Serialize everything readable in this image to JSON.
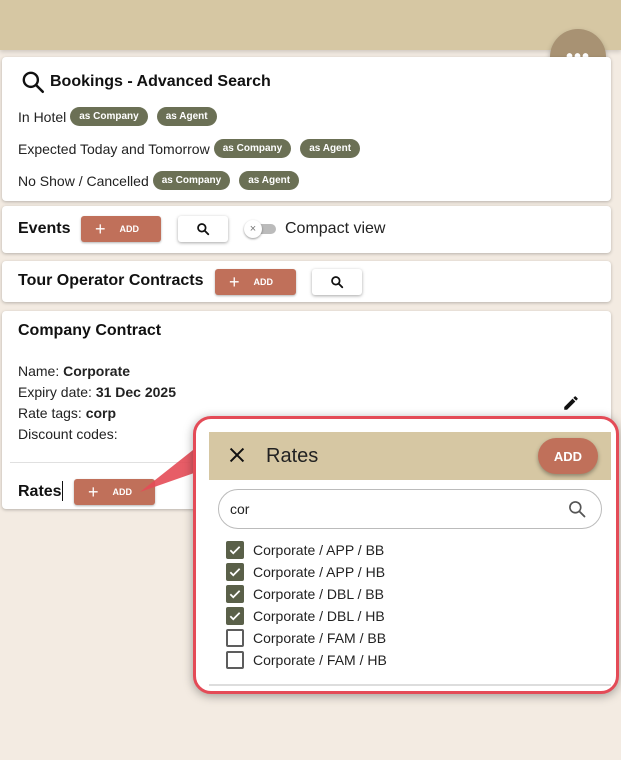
{
  "header": {
    "more_icon": "more-horizontal-icon",
    "more_glyph": "•••"
  },
  "bookings": {
    "title": "Bookings - Advanced Search",
    "rows": [
      {
        "label": "In Hotel",
        "chip1": "as Company",
        "chip2": "as Agent"
      },
      {
        "label": "Expected Today and Tomorrow",
        "chip1": "as Company",
        "chip2": "as Agent"
      },
      {
        "label": "No Show / Cancelled",
        "chip1": "as Company",
        "chip2": "as Agent"
      }
    ]
  },
  "events": {
    "title": "Events",
    "add_label": "ADD",
    "compact_label": "Compact view",
    "compact_on": false
  },
  "tour_operator": {
    "title": "Tour Operator Contracts",
    "add_label": "ADD"
  },
  "company_contract": {
    "title": "Company Contract",
    "name_label": "Name:",
    "name_value": "Corporate",
    "expiry_label": "Expiry date:",
    "expiry_value": "31 Dec 2025",
    "rate_tags_label": "Rate tags:",
    "rate_tags_value": "corp",
    "discount_label": "Discount codes:",
    "rates_title": "Rates",
    "rates_add_label": "ADD"
  },
  "rates_popup": {
    "title": "Rates",
    "add_label": "ADD",
    "search_value": "cor",
    "items": [
      {
        "label": "Corporate / APP / BB",
        "checked": true
      },
      {
        "label": "Corporate / APP / HB",
        "checked": true
      },
      {
        "label": "Corporate / DBL / BB",
        "checked": true
      },
      {
        "label": "Corporate / DBL / HB",
        "checked": true
      },
      {
        "label": "Corporate / FAM / BB",
        "checked": false
      },
      {
        "label": "Corporate / FAM / HB",
        "checked": false
      }
    ]
  },
  "colors": {
    "accent": "#c0705a",
    "header": "#d6c7a3",
    "chip": "#6b7055",
    "highlight": "#e44b57"
  }
}
